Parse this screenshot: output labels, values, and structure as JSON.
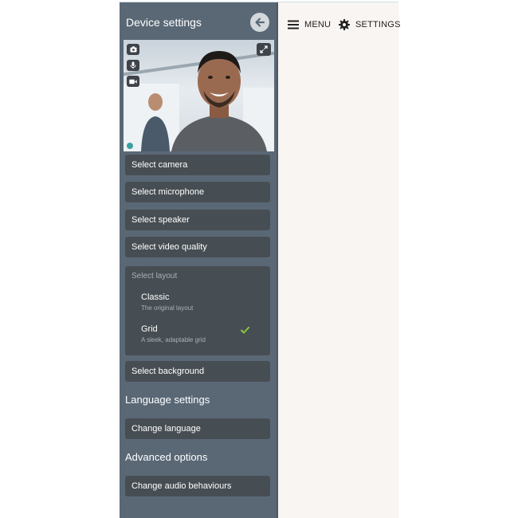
{
  "sidebar": {
    "title": "Device settings",
    "device_items": {
      "camera": "Select camera",
      "microphone": "Select microphone",
      "speaker": "Select speaker",
      "video_quality": "Select video quality"
    },
    "layout": {
      "heading": "Select layout",
      "options": [
        {
          "title": "Classic",
          "subtitle": "The original layout",
          "selected": false
        },
        {
          "title": "Grid",
          "subtitle": "A sleek, adaptable grid",
          "selected": true
        }
      ]
    },
    "background_item": "Select background",
    "language_section": {
      "title": "Language settings",
      "item": "Change language"
    },
    "advanced_section": {
      "title": "Advanced options",
      "item": "Change audio behaviours"
    }
  },
  "topbar": {
    "menu_label": "MENU",
    "settings_label": "SETTINGS"
  },
  "colors": {
    "sidebar_bg": "#5a6876",
    "item_bg": "#474e53",
    "check_color": "#8cc63f",
    "main_bg": "#f8f5f2"
  },
  "icons": [
    "back-arrow-icon",
    "camera-icon",
    "microphone-icon",
    "video-icon",
    "expand-icon",
    "checkmark-icon",
    "hamburger-menu-icon",
    "gear-icon"
  ]
}
